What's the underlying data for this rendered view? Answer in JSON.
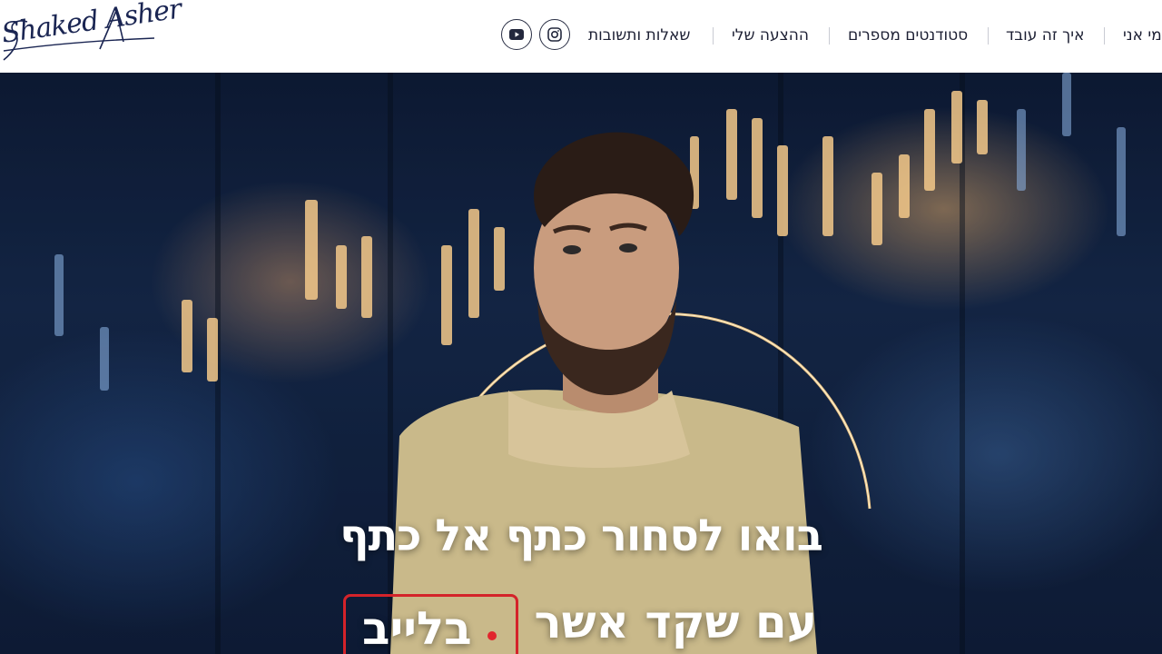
{
  "logo": {
    "text": "Shaked Asher"
  },
  "social": [
    {
      "name": "youtube-icon"
    },
    {
      "name": "instagram-icon"
    }
  ],
  "nav": [
    {
      "label": "מי אני"
    },
    {
      "label": "איך זה עובד"
    },
    {
      "label": "סטודנטים מספרים"
    },
    {
      "label": "ההצעה שלי"
    },
    {
      "label": "שאלות ותשובות"
    }
  ],
  "hero": {
    "headline_line1": "בואו לסחור כתף אל כתף",
    "headline_line2": "עם שקד אשר",
    "live_label": "בלייב"
  },
  "colors": {
    "accent": "#d4232a",
    "nav_text": "#1c1f33",
    "logo": "#1a2552"
  }
}
